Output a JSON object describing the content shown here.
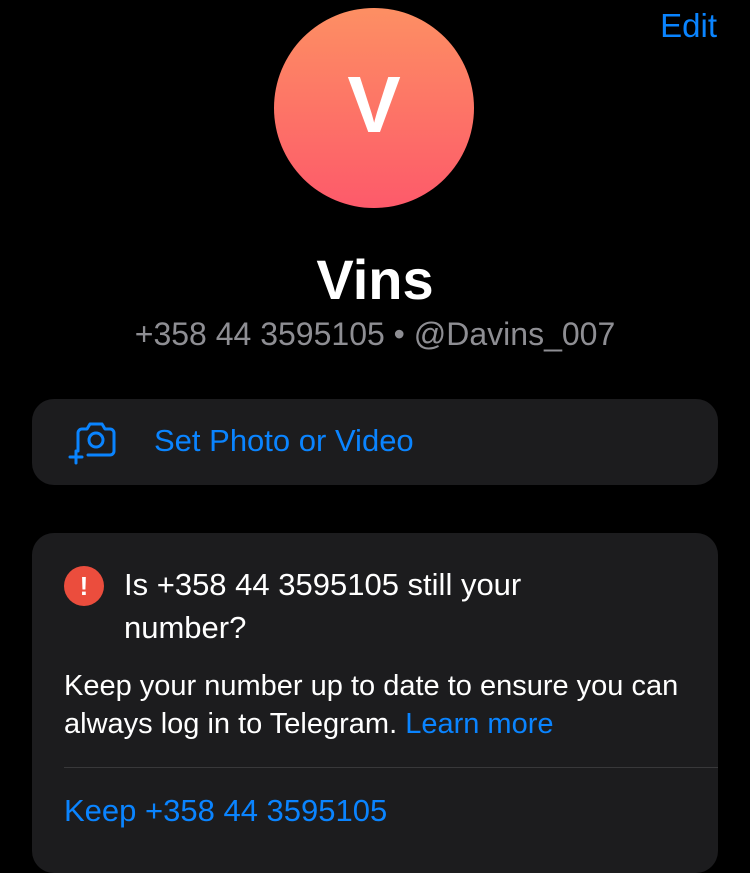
{
  "header": {
    "edit_label": "Edit"
  },
  "profile": {
    "avatar_initial": "V",
    "name": "Vins",
    "phone": "+358 44 3595105",
    "separator": " • ",
    "username": "@Davins_007",
    "avatar_gradient": [
      "#fd8f63",
      "#fd5a6a"
    ]
  },
  "photo_card": {
    "label": "Set Photo or Video",
    "icon": "camera-add-icon"
  },
  "number_check": {
    "icon": "exclamation-icon",
    "title": "Is +358 44 3595105 still your number?",
    "body": "Keep your number up to date to ensure you can always log in to Telegram. ",
    "learn_more": "Learn more",
    "keep_label": "Keep +358 44 3595105"
  },
  "colors": {
    "background": "#000000",
    "card": "#1c1c1e",
    "accent": "#0a84ff",
    "secondary_text": "#8e8e93",
    "warning": "#eb4d3d"
  }
}
